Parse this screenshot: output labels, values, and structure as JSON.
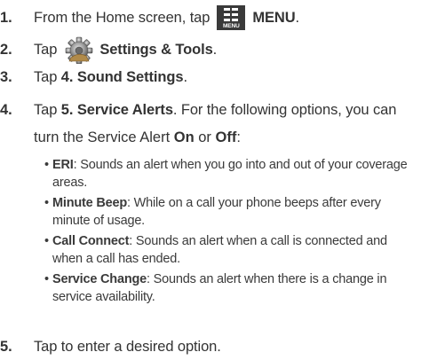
{
  "steps": [
    {
      "num": "1.",
      "pre": "From the Home screen, tap",
      "bold": "MENU",
      "post": "."
    },
    {
      "num": "2.",
      "pre": "Tap",
      "bold": "Settings & Tools",
      "post": "."
    },
    {
      "num": "3.",
      "pre": "Tap ",
      "bold": "4. Sound Settings",
      "post": "."
    },
    {
      "num": "4.",
      "pre": "Tap ",
      "bold": "5. Service Alerts",
      "post": ". For the following options, you can"
    },
    {
      "num": "5.",
      "pre": "Tap to enter a desired option.",
      "bold": "",
      "post": ""
    }
  ],
  "step4_cont": {
    "pre": "turn the Service Alert ",
    "on": "On",
    "mid": " or ",
    "off": "Off",
    "post": ":"
  },
  "menu_icon_caption": "MENU",
  "icons": {
    "menu": "menu-grid-icon",
    "settings": "gear-icon"
  },
  "bullets": [
    {
      "dot": "•",
      "term": "ERI",
      "desc": ": Sounds an alert when you go into and out of your coverage areas."
    },
    {
      "dot": "•",
      "term": "Minute Beep",
      "desc": ": While on a call your phone beeps after every minute of usage."
    },
    {
      "dot": "•",
      "term": "Call Connect",
      "desc": ": Sounds an alert when a call is connected and when a call has ended."
    },
    {
      "dot": "•",
      "term": "Service Change",
      "desc": ": Sounds an alert when there is a change in service availability."
    }
  ]
}
